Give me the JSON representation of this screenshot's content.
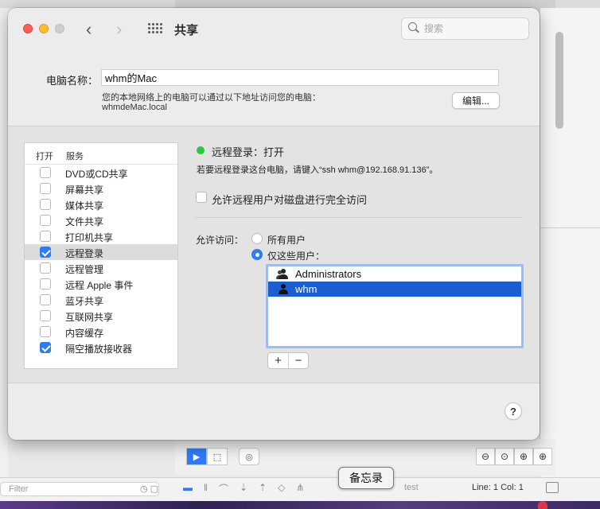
{
  "window": {
    "title": "共享",
    "search_placeholder": "搜索"
  },
  "computer": {
    "name_label": "电脑名称：",
    "name_value": "whm的Mac",
    "address_description": "您的本地网络上的电脑可以通过以下地址访问您的电脑：",
    "hostname": "whmdeMac.local",
    "edit_button": "编辑..."
  },
  "services": {
    "header_on": "打开",
    "header_service": "服务",
    "items": [
      {
        "label": "DVD或CD共享",
        "checked": false,
        "selected": false
      },
      {
        "label": "屏幕共享",
        "checked": false,
        "selected": false
      },
      {
        "label": "媒体共享",
        "checked": false,
        "selected": false
      },
      {
        "label": "文件共享",
        "checked": false,
        "selected": false
      },
      {
        "label": "打印机共享",
        "checked": false,
        "selected": false
      },
      {
        "label": "远程登录",
        "checked": true,
        "selected": true
      },
      {
        "label": "远程管理",
        "checked": false,
        "selected": false
      },
      {
        "label": "远程 Apple 事件",
        "checked": false,
        "selected": false
      },
      {
        "label": "蓝牙共享",
        "checked": false,
        "selected": false
      },
      {
        "label": "互联网共享",
        "checked": false,
        "selected": false
      },
      {
        "label": "内容缓存",
        "checked": false,
        "selected": false
      },
      {
        "label": "隔空播放接收器",
        "checked": true,
        "selected": false
      }
    ]
  },
  "detail": {
    "status": "远程登录：打开",
    "status_color": "#2bc840",
    "hint": "若要远程登录这台电脑，请键入“ssh whm@192.168.91.136”。",
    "disk_access_label": "允许远程用户对磁盘进行完全访问",
    "allow_access_label": "允许访问：",
    "radio_all": "所有用户",
    "radio_only": "仅这些用户：",
    "users": [
      {
        "name": "Administrators",
        "icon": "group-icon",
        "selected": false
      },
      {
        "name": "whm",
        "icon": "user-icon",
        "selected": true
      }
    ],
    "add_symbol": "+",
    "remove_symbol": "−"
  },
  "help_symbol": "?",
  "background": {
    "filter_placeholder": "Filter",
    "test_label": "test",
    "line_col": "Line: 1  Col: 1",
    "tooltip": "备忘录"
  },
  "colors": {
    "accent": "#2e7bf6",
    "selection": "#1b5ed2"
  }
}
